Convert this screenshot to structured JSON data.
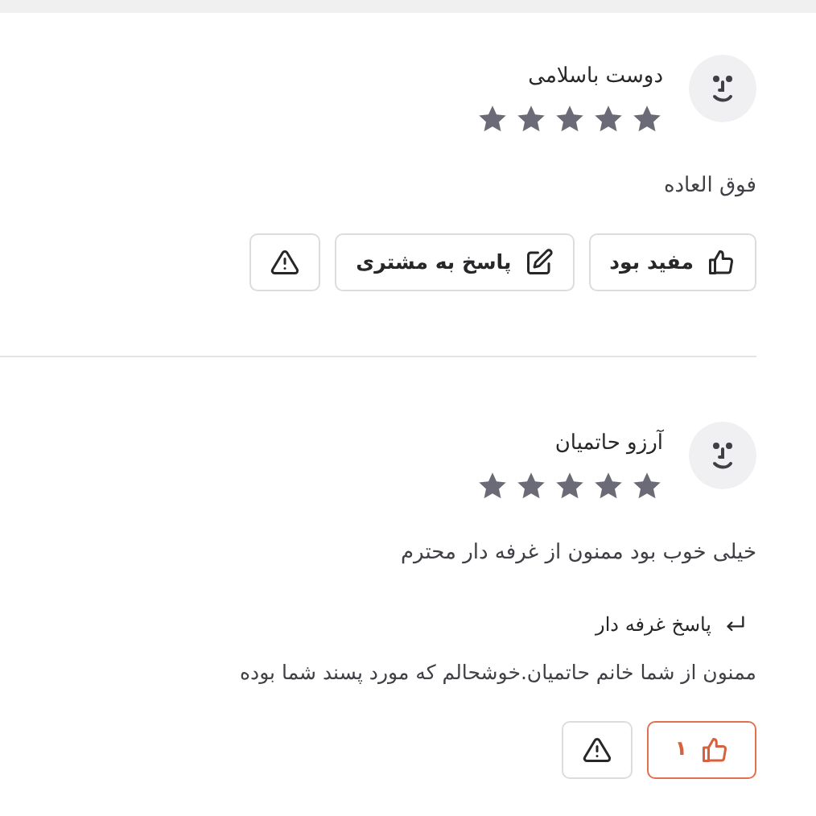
{
  "reviews": [
    {
      "name": "دوست باسلامی",
      "stars": 5,
      "comment": "فوق العاده",
      "actions": [
        {
          "kind": "helpful",
          "label": "مفید بود",
          "liked": false
        },
        {
          "kind": "reply",
          "label": "پاسخ به مشتری"
        },
        {
          "kind": "report"
        }
      ]
    },
    {
      "name": "آرزو حاتمیان",
      "stars": 5,
      "comment": "خیلی خوب بود ممنون از غرفه دار محترم",
      "reply": {
        "title": "پاسخ غرفه دار",
        "text": "ممنون از شما خانم حاتمیان.خوشحالم که مورد پسند شما بوده"
      },
      "actions": [
        {
          "kind": "helpful",
          "count": "۱",
          "liked": true
        },
        {
          "kind": "report"
        }
      ]
    }
  ]
}
